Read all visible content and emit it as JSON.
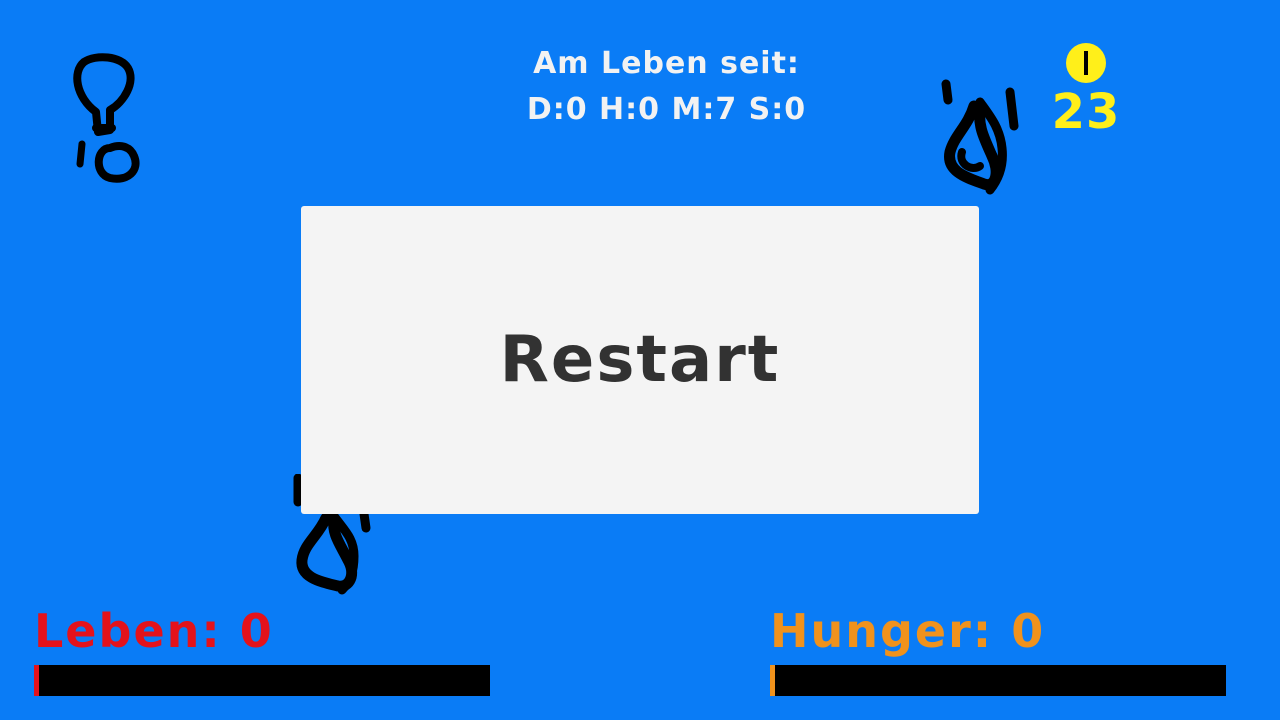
{
  "hud": {
    "alive_label": "Am Leben seit:",
    "alive_time": "D:0 H:0 M:7 S:0",
    "coin_count": "23",
    "coin_icon": "coin-icon"
  },
  "menu": {
    "restart_label": "Restart"
  },
  "stats": {
    "life_label": "Leben: 0",
    "life_value": 0,
    "hunger_label": "Hunger: 0",
    "hunger_value": 0
  },
  "colors": {
    "background": "#0a7cf6",
    "life": "#e4121b",
    "hunger": "#f0921c",
    "coin": "#ffef1a",
    "panel": "#f4f4f4",
    "bar_track": "#000000"
  }
}
